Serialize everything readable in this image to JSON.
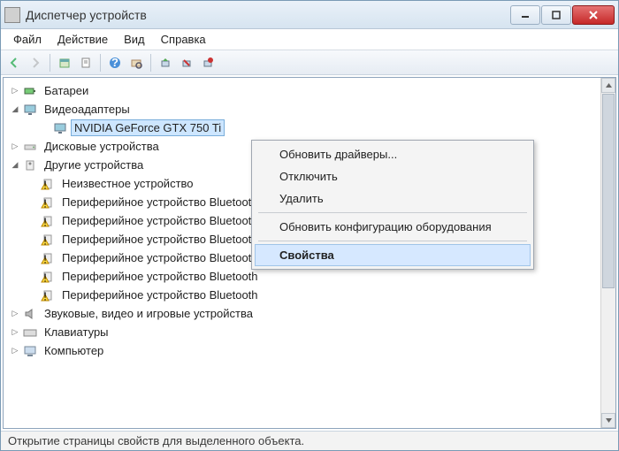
{
  "title": "Диспетчер устройств",
  "menus": {
    "file": "Файл",
    "action": "Действие",
    "view": "Вид",
    "help": "Справка"
  },
  "tree": {
    "batteries": "Батареи",
    "display_adapters": "Видеоадаптеры",
    "gpu": "NVIDIA GeForce GTX 750 Ti",
    "disk_drives": "Дисковые устройства",
    "other_devices": "Другие устройства",
    "unknown_device": "Неизвестное устройство",
    "pb1": "Периферийное устройство Bluetooth",
    "pb2": "Периферийное устройство Bluetooth",
    "pb3": "Периферийное устройство Bluetooth",
    "pb4": "Периферийное устройство Bluetooth",
    "pb5": "Периферийное устройство Bluetooth",
    "pb6": "Периферийное устройство Bluetooth",
    "sound": "Звуковые, видео и игровые устройства",
    "keyboards": "Клавиатуры",
    "computer": "Компьютер"
  },
  "context": {
    "update": "Обновить драйверы...",
    "disable": "Отключить",
    "remove": "Удалить",
    "scan": "Обновить конфигурацию оборудования",
    "properties": "Свойства"
  },
  "status": "Открытие страницы свойств для выделенного объекта.",
  "icons": {
    "app": "device-manager-icon",
    "arrow_back": "arrow-back-icon",
    "arrow_fwd": "arrow-forward-icon"
  }
}
